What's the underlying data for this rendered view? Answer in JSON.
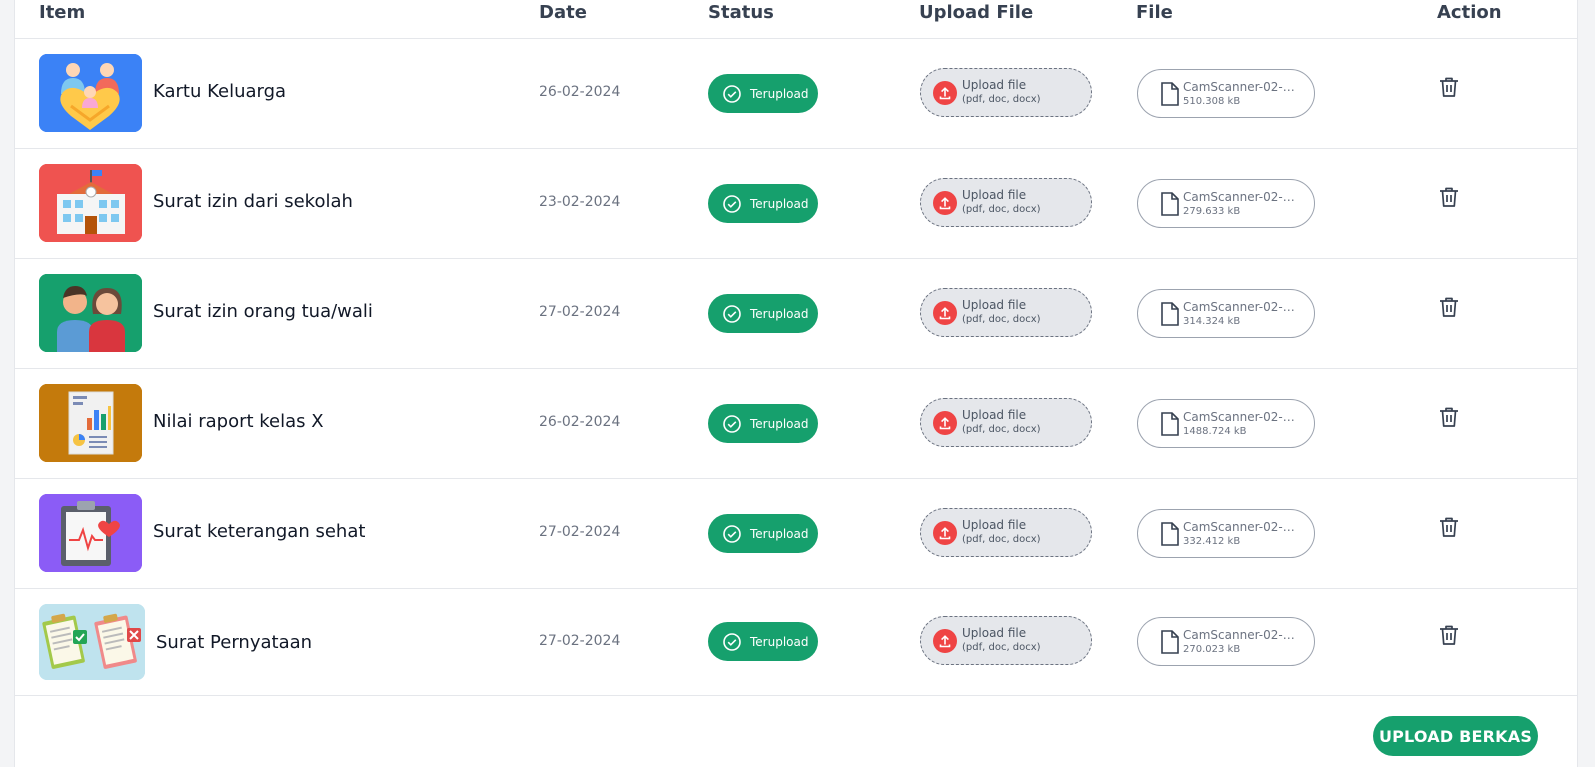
{
  "table": {
    "headers": {
      "item": "Item",
      "date": "Date",
      "status": "Status",
      "upload_file": "Upload File",
      "file": "File",
      "action": "Action"
    },
    "rows": [
      {
        "name": "Kartu Keluarga",
        "date": "26-02-2024",
        "status": "Terupload",
        "upload_label": "Upload file",
        "upload_hint": "(pdf, doc, docx)",
        "file_name": "CamScanner-02-2...",
        "file_size": "510.308 kB",
        "thumb_icon": "family-icon",
        "thumb_color": "#3b82f6"
      },
      {
        "name": "Surat izin dari sekolah",
        "date": "23-02-2024",
        "status": "Terupload",
        "upload_label": "Upload file",
        "upload_hint": "(pdf, doc, docx)",
        "file_name": "CamScanner-02-2...",
        "file_size": "279.633 kB",
        "thumb_icon": "school-building-icon",
        "thumb_color": "#ef5350"
      },
      {
        "name": "Surat izin orang tua/wali",
        "date": "27-02-2024",
        "status": "Terupload",
        "upload_label": "Upload file",
        "upload_hint": "(pdf, doc, docx)",
        "file_name": "CamScanner-02-2...",
        "file_size": "314.324 kB",
        "thumb_icon": "parents-icon",
        "thumb_color": "#16a06d"
      },
      {
        "name": "Nilai raport kelas X",
        "date": "26-02-2024",
        "status": "Terupload",
        "upload_label": "Upload file",
        "upload_hint": "(pdf, doc, docx)",
        "file_name": "CamScanner-02-2...",
        "file_size": "1488.724 kB",
        "thumb_icon": "report-chart-icon",
        "thumb_color": "#c47a0c"
      },
      {
        "name": "Surat keterangan sehat",
        "date": "27-02-2024",
        "status": "Terupload",
        "upload_label": "Upload file",
        "upload_hint": "(pdf, doc, docx)",
        "file_name": "CamScanner-02-2...",
        "file_size": "332.412 kB",
        "thumb_icon": "medical-clipboard-icon",
        "thumb_color": "#8b5cf6"
      },
      {
        "name": "Surat Pernyataan",
        "date": "27-02-2024",
        "status": "Terupload",
        "upload_label": "Upload file",
        "upload_hint": "(pdf, doc, docx)",
        "file_name": "CamScanner-02-2...",
        "file_size": "270.023 kB",
        "thumb_icon": "approval-clipboards-icon",
        "thumb_color": "#bfe3ee"
      }
    ]
  },
  "footer": {
    "upload_button": "UPLOAD BERKAS"
  },
  "colors": {
    "accent": "#16a06d",
    "upload_icon": "#ef4444"
  }
}
